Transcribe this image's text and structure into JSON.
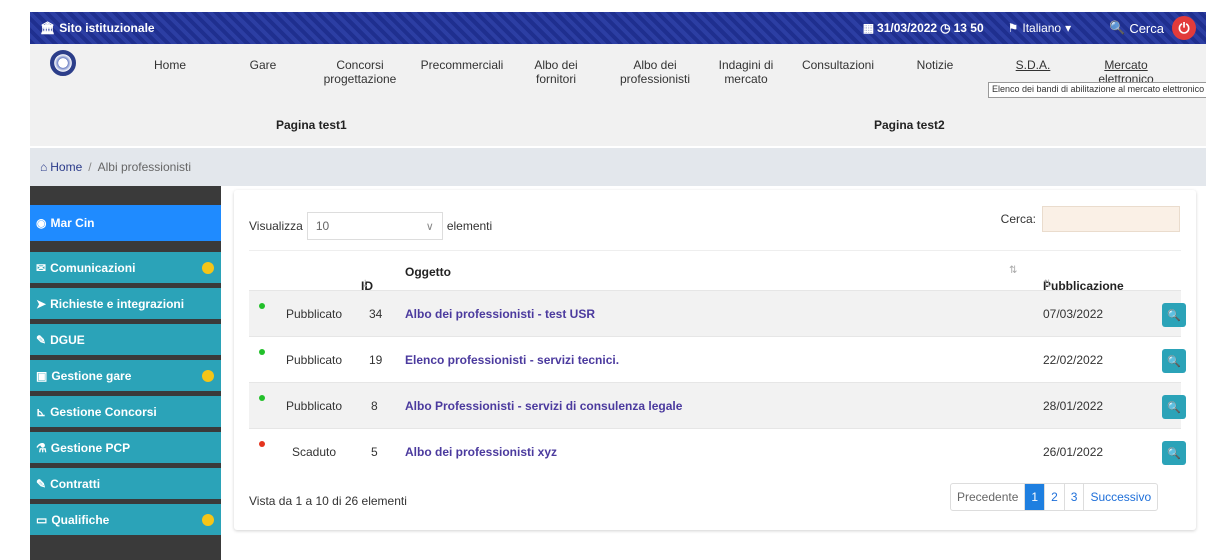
{
  "topbar": {
    "site_label": "Sito istituzionale",
    "date": "31/03/2022",
    "time": "13 50",
    "language": "Italiano",
    "search_label": "Cerca"
  },
  "nav": {
    "items": [
      {
        "label": "Home"
      },
      {
        "label": "Gare"
      },
      {
        "label": "Concorsi progettazione"
      },
      {
        "label": "Precommerciali"
      },
      {
        "label": "Albo dei fornitori"
      },
      {
        "label": "Albo dei professionisti"
      },
      {
        "label": "Indagini di mercato"
      },
      {
        "label": "Consultazioni"
      },
      {
        "label": "Notizie"
      },
      {
        "label": "S.D.A."
      },
      {
        "label": "Mercato elettronico"
      }
    ],
    "tooltip": "Elenco dei bandi di abilitazione al mercato elettronico",
    "subitems": [
      {
        "label": "Pagina test1"
      },
      {
        "label": "Pagina test2"
      }
    ]
  },
  "breadcrumb": {
    "home": "Home",
    "current": "Albi professionisti"
  },
  "sidebar": {
    "user": "Mar Cin",
    "items": [
      {
        "label": "Comunicazioni",
        "badge": true
      },
      {
        "label": "Richieste e integrazioni",
        "badge": false
      },
      {
        "label": "DGUE",
        "badge": false
      },
      {
        "label": "Gestione gare",
        "badge": true
      },
      {
        "label": "Gestione Concorsi",
        "badge": false
      },
      {
        "label": "Gestione PCP",
        "badge": false
      },
      {
        "label": "Contratti",
        "badge": false
      },
      {
        "label": "Qualifiche",
        "badge": true
      }
    ]
  },
  "table": {
    "length_prefix": "Visualizza",
    "length_value": "10",
    "length_suffix": "elementi",
    "search_label": "Cerca:",
    "headers": {
      "id": "ID",
      "object": "Oggetto",
      "date": "Pubblicazione"
    },
    "rows": [
      {
        "status": "Pubblicato",
        "status_color": "#22c02a",
        "id": "34",
        "object": "Albo dei professionisti - test USR",
        "date": "07/03/2022"
      },
      {
        "status": "Pubblicato",
        "status_color": "#22c02a",
        "id": "19",
        "object": "Elenco professionisti - servizi tecnici.",
        "date": "22/02/2022"
      },
      {
        "status": "Pubblicato",
        "status_color": "#22c02a",
        "id": "8",
        "object": "Albo Professionisti - servizi di consulenza legale",
        "date": "28/01/2022"
      },
      {
        "status": "Scaduto",
        "status_color": "#e5341e",
        "id": "5",
        "object": "Albo dei professionisti xyz",
        "date": "26/01/2022"
      }
    ],
    "info": "Vista da 1 a 10 di 26 elementi",
    "pager": {
      "prev": "Precedente",
      "pages": [
        "1",
        "2",
        "3"
      ],
      "next": "Successivo"
    }
  }
}
